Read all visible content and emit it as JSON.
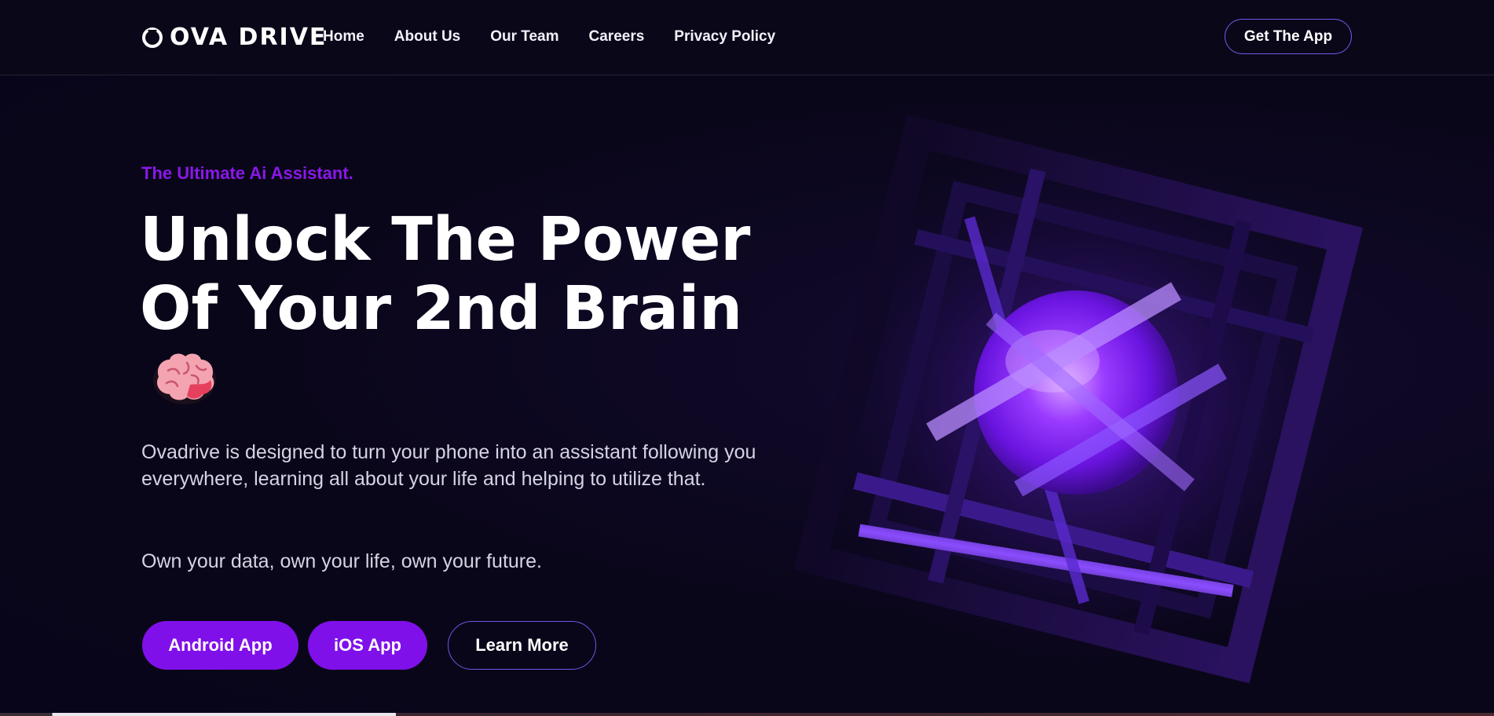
{
  "header": {
    "logo_text": "OVA DRIVE",
    "nav": [
      {
        "label": "Home"
      },
      {
        "label": "About Us"
      },
      {
        "label": "Our Team"
      },
      {
        "label": "Careers"
      },
      {
        "label": "Privacy Policy"
      }
    ],
    "cta_label": "Get The App"
  },
  "hero": {
    "eyebrow": "The Ultimate Ai Assistant.",
    "headline_line1": "Unlock The Power",
    "headline_line2": "Of Your 2nd Brain",
    "description": "Ovadrive is designed to turn your phone into an assistant following you everywhere, learning all about your life and helping to utilize that.",
    "tagline": "Own your data, own your life, own your future.",
    "buttons": {
      "android": "Android App",
      "ios": "iOS App",
      "learn_more": "Learn More"
    },
    "icons": {
      "brain": "brain-icon",
      "art": "glowing-cube-sphere"
    }
  },
  "colors": {
    "background": "#0a0619",
    "accent": "#8010ea",
    "eyebrow": "#8a18e8",
    "outline": "#6f58e8"
  }
}
